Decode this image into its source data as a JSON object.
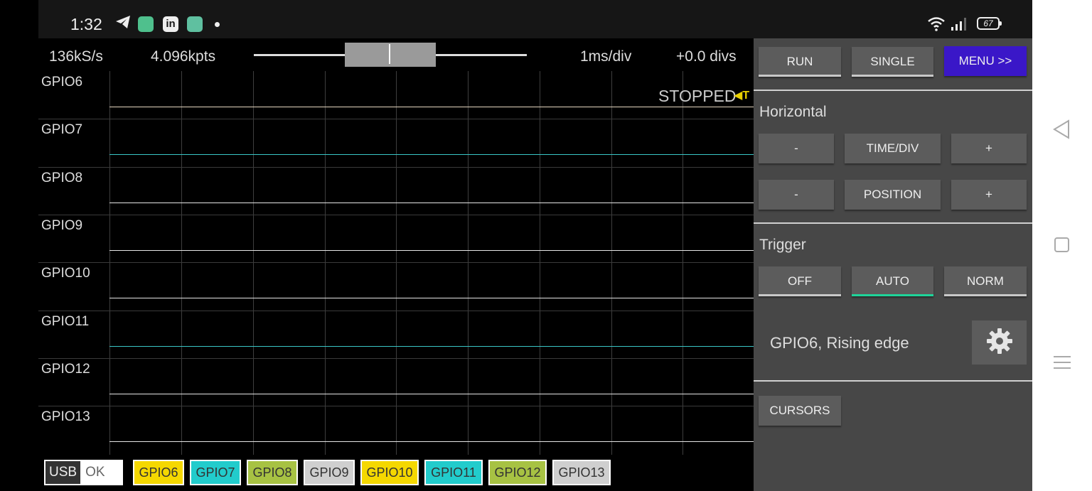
{
  "status_bar": {
    "time": "1:32",
    "battery_level": "67",
    "icons": [
      "telegram-icon",
      "app-icon",
      "linkedin-icon",
      "app-icon",
      "notification-dot-icon",
      "wifi-icon",
      "signal-icon",
      "battery-icon"
    ]
  },
  "scope_info": {
    "sample_rate": "136kS/s",
    "points": "4.096kpts",
    "time_per_div": "1ms/div",
    "position": "+0.0 divs"
  },
  "plot": {
    "state": "STOPPED",
    "trigger_marker": "T",
    "channels": [
      "GPIO6",
      "GPIO7",
      "GPIO8",
      "GPIO9",
      "GPIO10",
      "GPIO11",
      "GPIO12",
      "GPIO13"
    ],
    "trace_colors": [
      "#e6d6c0",
      "#39c6c6",
      "#e6e6e6",
      "#e6e6e6",
      "#e6e6e6",
      "#39c6c6",
      "#e6e6e6",
      "#e6e6e6"
    ]
  },
  "bottom_bar": {
    "usb_label": "USB",
    "usb_status": "OK",
    "channel_badges": [
      {
        "label": "GPIO6",
        "color": "#f5d800"
      },
      {
        "label": "GPIO7",
        "color": "#22cccc"
      },
      {
        "label": "GPIO8",
        "color": "#a7c243"
      },
      {
        "label": "GPIO9",
        "color": "#cfcfcf"
      },
      {
        "label": "GPIO10",
        "color": "#f5d800"
      },
      {
        "label": "GPIO11",
        "color": "#22cccc"
      },
      {
        "label": "GPIO12",
        "color": "#a7c243"
      },
      {
        "label": "GPIO13",
        "color": "#cfcfcf"
      }
    ]
  },
  "panel": {
    "run_label": "RUN",
    "single_label": "SINGLE",
    "menu_label": "MENU >>",
    "menu_color": "#3a17c8",
    "horizontal_title": "Horizontal",
    "time_minus_label": "-",
    "time_div_label": "TIME/DIV",
    "time_plus_label": "+",
    "pos_minus_label": "-",
    "position_label": "POSITION",
    "pos_plus_label": "+",
    "trigger_title": "Trigger",
    "trig_off_label": "OFF",
    "trig_auto_label": "AUTO",
    "trig_norm_label": "NORM",
    "trigger_mode_selected": "AUTO",
    "trigger_description": "GPIO6, Rising edge",
    "cursors_label": "CURSORS"
  }
}
